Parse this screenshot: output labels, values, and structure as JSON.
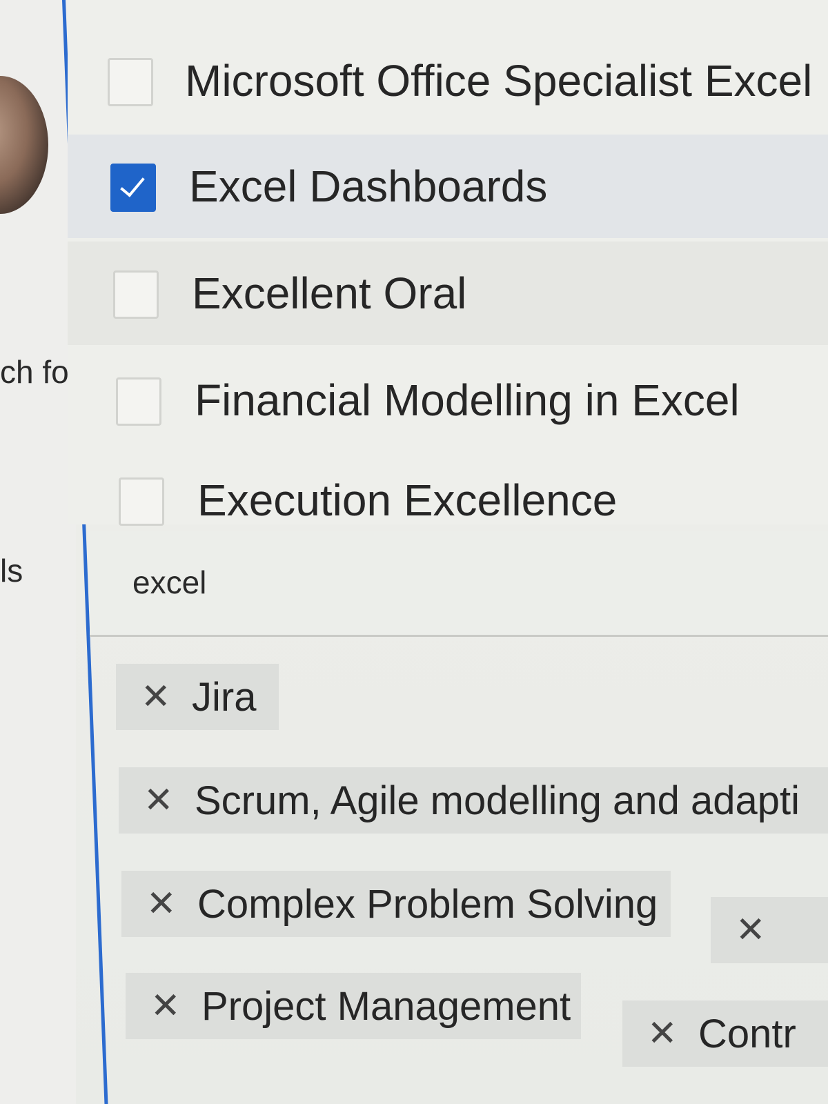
{
  "background": {
    "partial_text_1": "ch fo",
    "partial_text_2": "ls"
  },
  "options": [
    {
      "label": "Microsoft Office Specialist Excel",
      "checked": false
    },
    {
      "label": "Excel Dashboards",
      "checked": true
    },
    {
      "label": "Excellent Oral",
      "checked": false
    },
    {
      "label": "Financial Modelling in Excel",
      "checked": false
    },
    {
      "label": "Execution Excellence",
      "checked": false
    }
  ],
  "search": {
    "value": "excel"
  },
  "chips": [
    {
      "label": "Jira",
      "remove": "✕"
    },
    {
      "label": "Scrum, Agile modelling and adapti",
      "remove": "✕"
    },
    {
      "label": "Complex Problem Solving",
      "remove": "✕"
    },
    {
      "label": "",
      "remove": "✕"
    },
    {
      "label": "Project Management",
      "remove": "✕"
    },
    {
      "label": "Contr",
      "remove": "✕"
    }
  ],
  "colors": {
    "accent": "#1f64c9",
    "panel_border": "#2c6bcf",
    "chip_bg": "#dcdedb"
  }
}
